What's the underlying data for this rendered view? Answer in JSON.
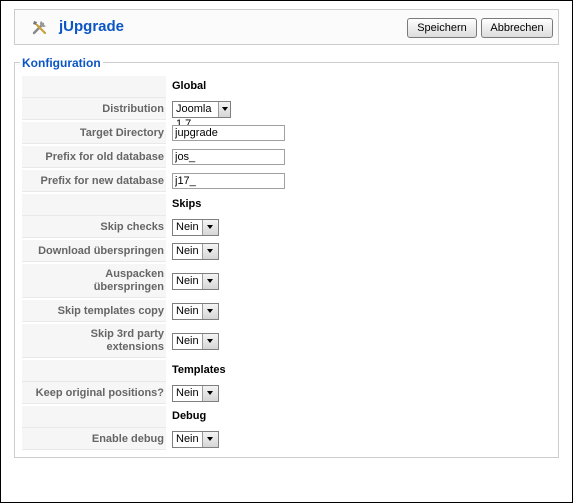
{
  "toolbar": {
    "title": "jUpgrade",
    "save_label": "Speichern",
    "cancel_label": "Abbrechen"
  },
  "config": {
    "legend": "Konfiguration",
    "global_heading": "Global",
    "skips_heading": "Skips",
    "templates_heading": "Templates",
    "debug_heading": "Debug",
    "distribution": {
      "label": "Distribution",
      "value": "Joomla 1.7"
    },
    "target_directory": {
      "label": "Target Directory",
      "value": "jupgrade"
    },
    "prefix_old": {
      "label": "Prefix for old database",
      "value": "jos_"
    },
    "prefix_new": {
      "label": "Prefix for new database",
      "value": "j17_"
    },
    "skip_checks": {
      "label": "Skip checks",
      "value": "Nein"
    },
    "skip_download": {
      "label": "Download überspringen",
      "value": "Nein"
    },
    "skip_unpack": {
      "label_line1": "Auspacken",
      "label_line2": "überspringen",
      "value": "Nein"
    },
    "skip_templates": {
      "label": "Skip templates copy",
      "value": "Nein"
    },
    "skip_3rdparty": {
      "label_line1": "Skip 3rd party",
      "label_line2": "extensions",
      "value": "Nein"
    },
    "keep_positions": {
      "label": "Keep original positions?",
      "value": "Nein"
    },
    "enable_debug": {
      "label": "Enable debug",
      "value": "Nein"
    }
  }
}
